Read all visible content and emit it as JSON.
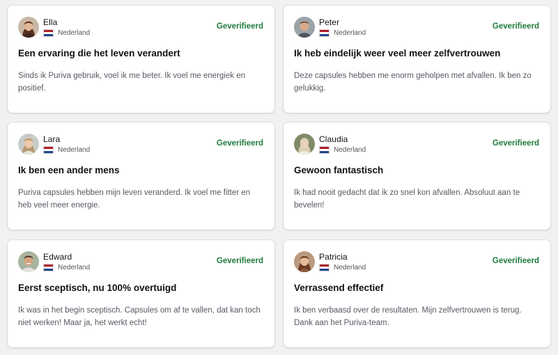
{
  "colors": {
    "background": "#f1f1f3",
    "card": "#ffffff",
    "verified": "#1f7a3c",
    "flag_red": "#ae1c28",
    "flag_white": "#ffffff",
    "flag_blue": "#21468b"
  },
  "reviews": [
    {
      "name": "Ella",
      "country": "Nederland",
      "flag_icon": "netherlands-flag-icon",
      "badge": "Geverifieerd",
      "title": "Een ervaring die het leven verandert",
      "text": "Sinds ik Puriva gebruik, voel ik me beter. Ik voel me energiek en positief."
    },
    {
      "name": "Peter",
      "country": "Nederland",
      "flag_icon": "netherlands-flag-icon",
      "badge": "Geverifieerd",
      "title": "Ik heb eindelijk weer veel meer zelfvertrouwen",
      "text": "Deze capsules hebben me enorm geholpen met afvallen. Ik ben zo gelukkig."
    },
    {
      "name": "Lara",
      "country": "Nederland",
      "flag_icon": "netherlands-flag-icon",
      "badge": "Geverifieerd",
      "title": "Ik ben een ander mens",
      "text": "Puriva capsules hebben mijn leven veranderd. Ik voel me fitter en heb veel meer energie."
    },
    {
      "name": "Claudia",
      "country": "Nederland",
      "flag_icon": "netherlands-flag-icon",
      "badge": "Geverifieerd",
      "title": "Gewoon fantastisch",
      "text": "Ik had nooit gedacht dat ik zo snel kon afvallen. Absoluut aan te bevelen!"
    },
    {
      "name": "Edward",
      "country": "Nederland",
      "flag_icon": "netherlands-flag-icon",
      "badge": "Geverifieerd",
      "title": "Eerst sceptisch, nu 100% overtuigd",
      "text": "Ik was in het begin sceptisch. Capsules om af te vallen, dat kan toch niet werken! Maar ja, het werkt echt!"
    },
    {
      "name": "Patricia",
      "country": "Nederland",
      "flag_icon": "netherlands-flag-icon",
      "badge": "Geverifieerd",
      "title": "Verrassend effectief",
      "text": "Ik ben verbaasd over de resultaten. Mijn zelfvertrouwen is terug. Dank aan het Puriva-team."
    }
  ]
}
